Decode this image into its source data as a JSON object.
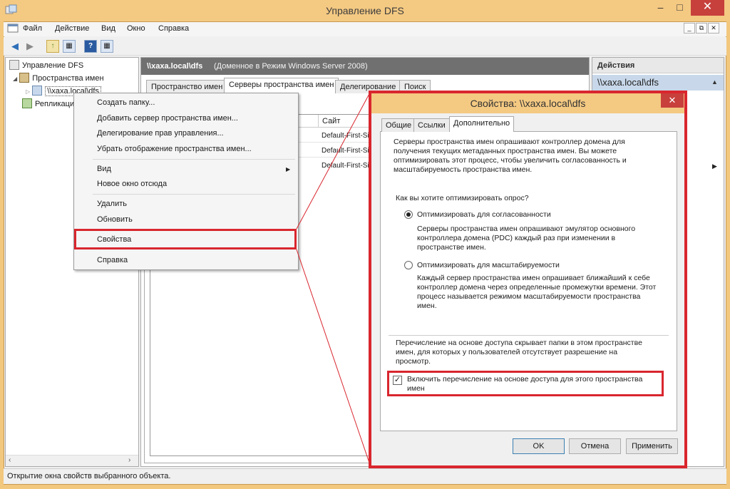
{
  "window": {
    "title": "Управление DFS"
  },
  "menu": [
    "Файл",
    "Действие",
    "Вид",
    "Окно",
    "Справка"
  ],
  "tree": {
    "root": "Управление DFS",
    "namespaces": "Пространства имен",
    "selected_namespace": "\\\\xaxa.local\\dfs",
    "replication": "Репликация"
  },
  "center": {
    "title": "\\\\xaxa.local\\dfs",
    "subtitle": "(Доменное в Режим Windows Server 2008)",
    "tabs": [
      "Пространство имен",
      "Серверы пространства имен",
      "Делегирование",
      "Поиск"
    ],
    "column_site": "Сайт",
    "rows": [
      "Default-First-Si",
      "Default-First-Si",
      "Default-First-Si"
    ]
  },
  "actions": {
    "title": "Действия",
    "selected": "\\\\xaxa.local\\dfs"
  },
  "context_menu": {
    "items": [
      "Создать папку...",
      "Добавить сервер пространства имен...",
      "Делегирование прав управления...",
      "Убрать отображение пространства имен...",
      "Вид",
      "Новое окно отсюда",
      "Удалить",
      "Обновить",
      "Свойства",
      "Справка"
    ]
  },
  "dialog": {
    "title": "Свойства: \\\\xaxa.local\\dfs",
    "tabs": [
      "Общие",
      "Ссылки",
      "Дополнительно"
    ],
    "intro_lines": [
      "Серверы пространства имен опрашивают контроллер домена для",
      "получения текущих метаданных пространства имен. Вы можете",
      "оптимизировать этот процесс, чтобы увеличить согласованность и",
      "масштабируемость пространства имен."
    ],
    "question": "Как вы хотите оптимизировать опрос?",
    "option1": {
      "label": "Оптимизировать для согласованности",
      "lines": [
        "Серверы пространства имен опрашивают эмулятор основного",
        "контроллера домена (PDC) каждый раз при изменении в",
        "пространстве имен."
      ],
      "selected": true
    },
    "option2": {
      "label": "Оптимизировать для масштабируемости",
      "lines": [
        "Каждый сервер пространства имен опрашивает ближайший к себе",
        "контроллер домена через определенные промежутки времени. Этот",
        "процесс называется режимом масштабируемости пространства",
        "имен."
      ],
      "selected": false
    },
    "abe_lines": [
      "Перечисление на основе доступа скрывает папки в этом пространстве",
      "имен, для которых у пользователей отсутствует разрешение на",
      "просмотр."
    ],
    "checkbox_lines": [
      "Включить перечисление на основе доступа для этого пространства",
      "имен"
    ],
    "checkbox_checked": true,
    "ok": "OK",
    "cancel": "Отмена",
    "apply": "Применить"
  },
  "status": "Открытие окна свойств выбранного объекта.",
  "colors": {
    "highlight": "#d9262e",
    "titlebar": "#f4c982",
    "close": "#c7403c"
  }
}
